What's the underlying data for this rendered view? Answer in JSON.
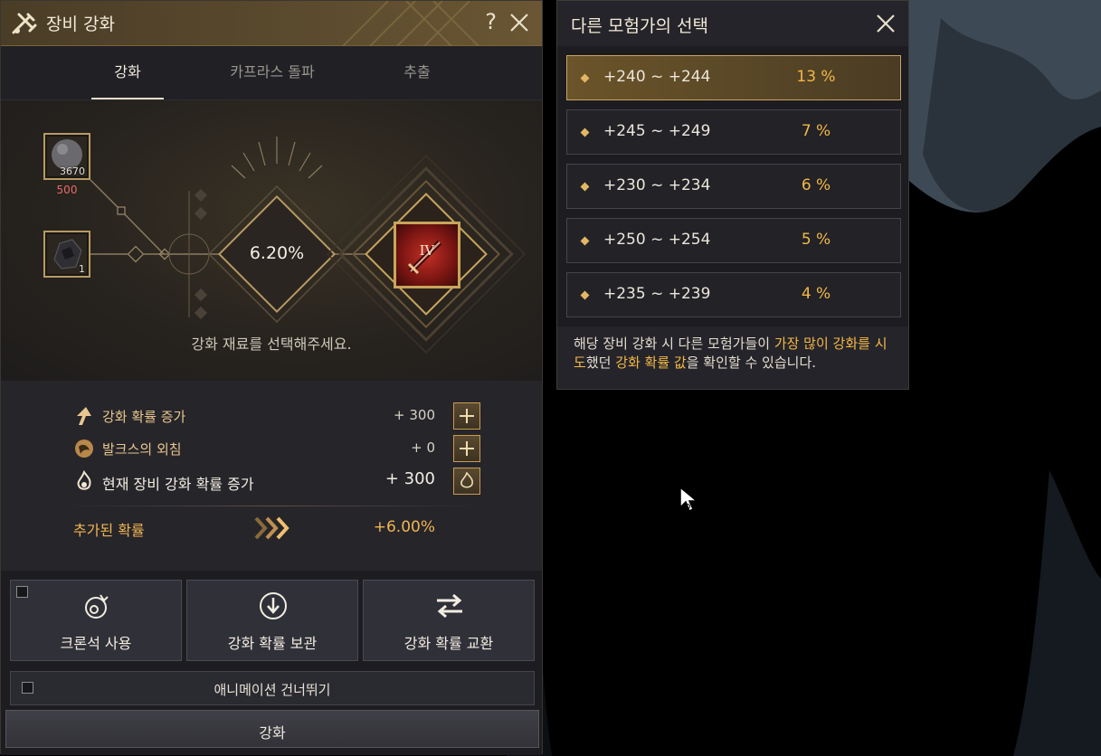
{
  "window": {
    "title": "장비 강화",
    "help": "?"
  },
  "tabs": [
    {
      "label": "강화",
      "active": true
    },
    {
      "label": "카프라스 돌파",
      "active": false
    },
    {
      "label": "추출",
      "active": false
    }
  ],
  "materials": [
    {
      "qty": "3670",
      "sub": "500"
    },
    {
      "qty": "1"
    }
  ],
  "success_chance": "6.20%",
  "item_rank": "IV",
  "hint": "강화 재료를 선택해주세요.",
  "stats": [
    {
      "label": "강화 확률 증가",
      "value": "+ 300"
    },
    {
      "label": "발크스의 외침",
      "value": "+ 0"
    },
    {
      "label": "현재 장비 강화 확률 증가",
      "value": "+ 300"
    }
  ],
  "added": {
    "label": "추가된 확률",
    "value": "+6.00%"
  },
  "actions": [
    {
      "label": "크론석 사용"
    },
    {
      "label": "강화 확률 보관"
    },
    {
      "label": "강화 확률 교환"
    }
  ],
  "skip_animation": "애니메이션 건너뛰기",
  "enhance_button": "강화",
  "popup": {
    "title": "다른 모험가의 선택",
    "items": [
      {
        "range": "+240 ~ +244",
        "pct": "13 %"
      },
      {
        "range": "+245 ~ +249",
        "pct": "7 %"
      },
      {
        "range": "+230 ~ +234",
        "pct": "6 %"
      },
      {
        "range": "+250 ~ +254",
        "pct": "5 %"
      },
      {
        "range": "+235 ~ +239",
        "pct": "4 %"
      }
    ],
    "note": {
      "p1": "해당 장비 강화 시 다른 모험가들이 ",
      "hl1": "가장 많이 강화를 시도",
      "p2": "했던 ",
      "hl2": "강화 확률 값",
      "p3": "을 확인할 수 있습니다."
    }
  },
  "colors": {
    "accent": "#f3b847",
    "gold_border": "#c9a460",
    "warn": "#e66a6a"
  }
}
